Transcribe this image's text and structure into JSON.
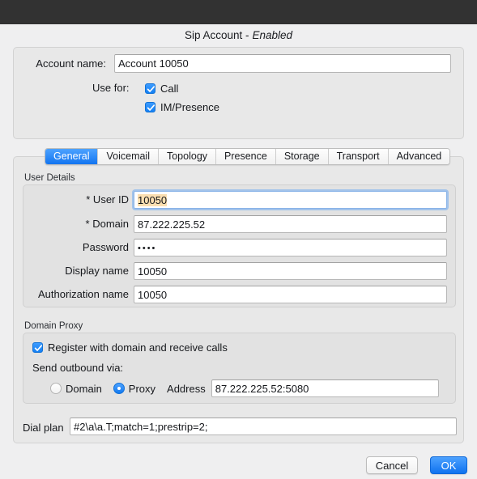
{
  "window": {
    "titlebar_color": "#323232",
    "dialog_title": "Sip Account -",
    "dialog_state": "Enabled"
  },
  "account": {
    "name_label": "Account name:",
    "name_value": "Account 10050",
    "use_for_label": "Use for:",
    "use_for": [
      {
        "label": "Call",
        "checked": true
      },
      {
        "label": "IM/Presence",
        "checked": true
      }
    ]
  },
  "tabs": [
    {
      "label": "General",
      "selected": true
    },
    {
      "label": "Voicemail",
      "selected": false
    },
    {
      "label": "Topology",
      "selected": false
    },
    {
      "label": "Presence",
      "selected": false
    },
    {
      "label": "Storage",
      "selected": false
    },
    {
      "label": "Transport",
      "selected": false
    },
    {
      "label": "Advanced",
      "selected": false
    }
  ],
  "user_details": {
    "group_title": "User Details",
    "fields": [
      {
        "label": "* User ID",
        "value": "10050",
        "focused": true,
        "highlighted": true
      },
      {
        "label": "* Domain",
        "value": "87.222.225.52",
        "focused": false,
        "highlighted": false
      },
      {
        "label": "Password",
        "value": "••••",
        "focused": false,
        "highlighted": false,
        "masked": true
      },
      {
        "label": "Display name",
        "value": "10050",
        "focused": false,
        "highlighted": false
      },
      {
        "label": "Authorization name",
        "value": "10050",
        "focused": false,
        "highlighted": false
      }
    ]
  },
  "domain_proxy": {
    "group_title": "Domain Proxy",
    "register_label": "Register with domain and receive calls",
    "register_checked": true,
    "send_outbound_label": "Send outbound via:",
    "options": [
      {
        "label": "Domain",
        "selected": false
      },
      {
        "label": "Proxy",
        "selected": true
      }
    ],
    "address_label": "Address",
    "address_value": "87.222.225.52:5080"
  },
  "dial_plan": {
    "label": "Dial plan",
    "value": "#2\\a\\a.T;match=1;prestrip=2;"
  },
  "footer": {
    "cancel_label": "Cancel",
    "ok_label": "OK",
    "accent_color": "#1279ef"
  }
}
